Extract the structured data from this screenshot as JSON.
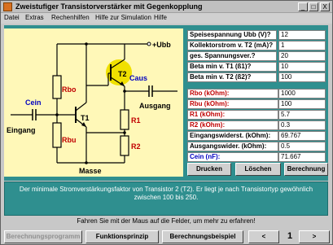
{
  "window": {
    "title": "Zweistufiger Transistorverstärker mit Gegenkopplung",
    "buttons": {
      "minimize": "_",
      "maximize": "□",
      "close": "X"
    }
  },
  "menu": {
    "items": [
      "Datei",
      "Extras",
      "Rechenhilfen",
      "Hilfe zur Simulation",
      "Hilfe"
    ]
  },
  "circuit": {
    "labels": {
      "ubb": "+Ubb",
      "rbo": "Rbo",
      "rbu": "Rbu",
      "t1": "T1",
      "t2": "T2",
      "r1": "R1",
      "r2": "R2",
      "cein": "Cein",
      "caus": "Caus",
      "eingang": "Eingang",
      "ausgang": "Ausgang",
      "masse": "Masse"
    },
    "colors": {
      "background": "#fff8b8",
      "highlight": "#f0e000",
      "capacitor_label": "#0000c0"
    }
  },
  "params": {
    "top": [
      {
        "label": "Speisespannung Ubb (V)?",
        "value": "12"
      },
      {
        "label": "Kollektorstrom v. T2 (mA)?",
        "value": "1"
      },
      {
        "label": "ges. Spannungsver.?",
        "value": "20"
      },
      {
        "label": "Beta min v. T1 (ß1)?",
        "value": "10"
      },
      {
        "label": "Beta min v. T2 (ß2)?",
        "value": "100"
      }
    ],
    "results": [
      {
        "label": "Rbo (kOhm):",
        "value": "1000",
        "color": "#c00000"
      },
      {
        "label": "Rbu (kOhm):",
        "value": "100",
        "color": "#c00000"
      },
      {
        "label": "R1 (kOhm):",
        "value": "5.7",
        "color": "#c00000"
      },
      {
        "label": "R2 (kOhm):",
        "value": "0.3",
        "color": "#c00000"
      },
      {
        "label": "Eingangswiderst. (kOhm):",
        "value": "69.767",
        "color": "#000000"
      },
      {
        "label": "Ausgangswider.  (kOhm):",
        "value": "0.5",
        "color": "#000000"
      },
      {
        "label": "Cein (nF):",
        "value": "71.667",
        "color": "#0000c0"
      }
    ]
  },
  "actions": {
    "drucken": "Drucken",
    "loeschen": "Löschen",
    "berechnung": "Berechnung"
  },
  "info": {
    "text": "Der minimale Stromverstärkungsfaktor von Transistor 2 (T2). Er liegt je nach Transistortyp gewöhnlich zwischen 100 bis 250."
  },
  "hint": "Fahren Sie mit der Maus auf die Felder, um mehr zu erfahren!",
  "nav": {
    "berechnungsprogramm": "Berechnungsprogramm",
    "funktionsprinzip": "Funktionsprinzip",
    "berechnungsbeispiel": "Berechnungsbeispiel",
    "prev": "<",
    "page": "1",
    "next": ">"
  }
}
